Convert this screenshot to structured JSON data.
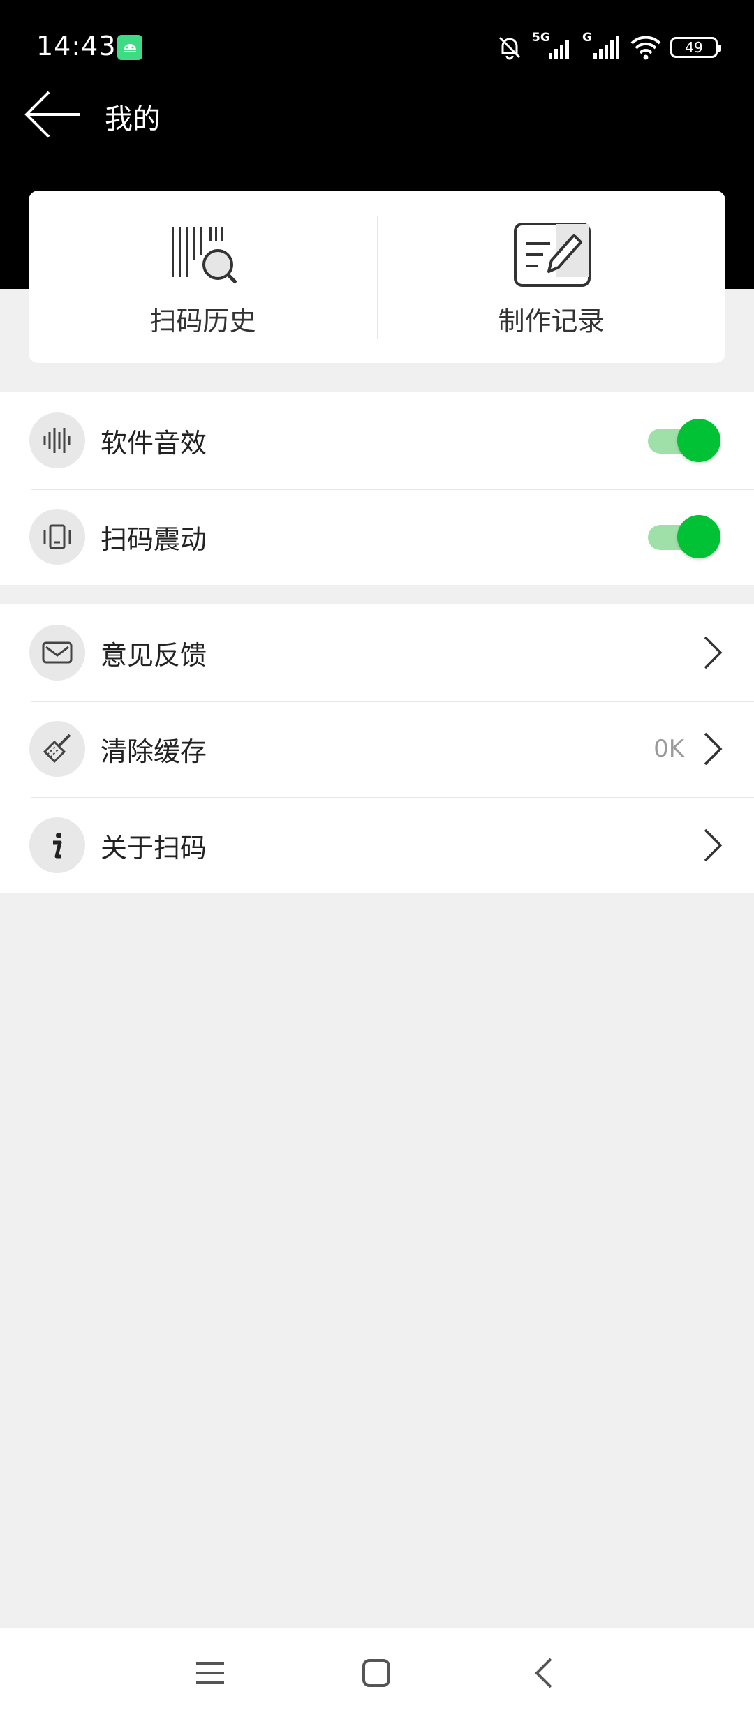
{
  "status_bar": {
    "time": "14:43",
    "network_label_1": "5G",
    "network_label_2": "G",
    "battery_level": "49",
    "icons": [
      "android-notification-icon",
      "mute-bell-icon",
      "signal-5g-icon",
      "signal-g-icon",
      "wifi-icon",
      "battery-icon"
    ]
  },
  "header": {
    "back_icon": "arrow-left-icon",
    "title": "我的"
  },
  "top_card": {
    "items": [
      {
        "label": "扫码历史",
        "icon": "barcode-search-icon"
      },
      {
        "label": "制作记录",
        "icon": "edit-note-icon"
      }
    ]
  },
  "settings_group": {
    "items": [
      {
        "label": "软件音效",
        "icon": "sound-wave-icon",
        "toggle_on": true
      },
      {
        "label": "扫码震动",
        "icon": "vibrate-icon",
        "toggle_on": true
      }
    ]
  },
  "menu_group": {
    "items": [
      {
        "label": "意见反馈",
        "icon": "mail-icon",
        "value": ""
      },
      {
        "label": "清除缓存",
        "icon": "broom-icon",
        "value": "0K"
      },
      {
        "label": "关于扫码",
        "icon": "info-icon",
        "value": ""
      }
    ]
  },
  "colors": {
    "header_bg": "#000000",
    "page_bg": "#f0f0f0",
    "toggle_knob": "#00c234",
    "toggle_track": "#9fe0a8"
  },
  "nav_bar": {
    "icons": [
      "menu-icon",
      "home-square-icon",
      "back-chevron-icon"
    ]
  }
}
